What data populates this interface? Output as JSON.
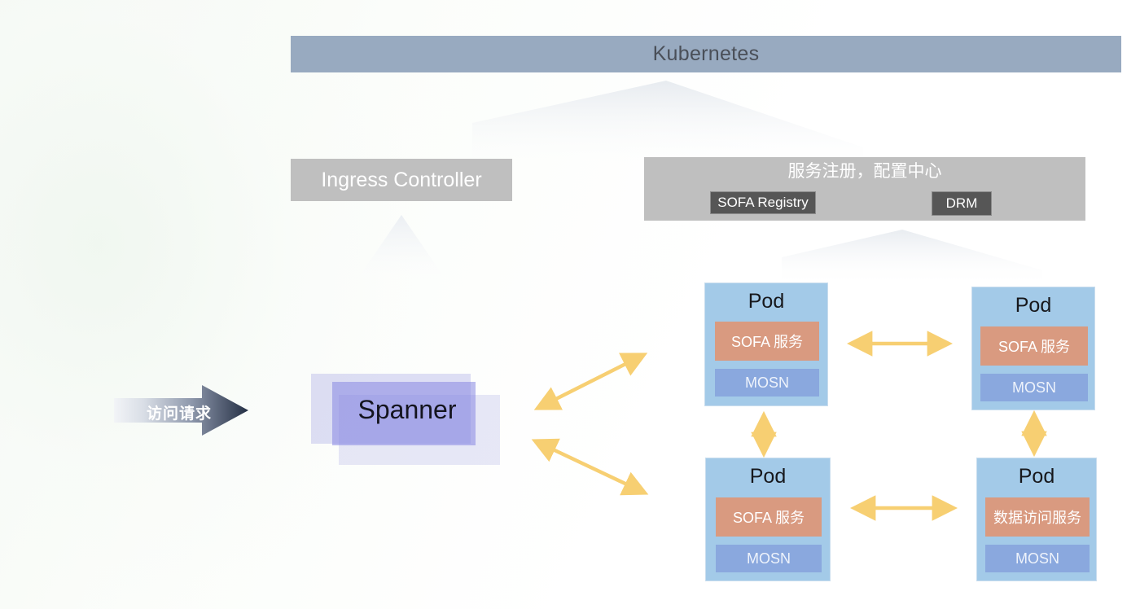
{
  "diagram": {
    "title": "Kubernetes",
    "platform": {
      "label": "Kubernetes",
      "color": "#98aac0"
    },
    "ingress": {
      "label": "Ingress Controller",
      "color": "#bfbfbf"
    },
    "registry": {
      "title": "服务注册，配置中心",
      "color": "#bfbfbf",
      "components": [
        {
          "label": "SOFA Registry",
          "color": "#565656"
        },
        {
          "label": "DRM",
          "color": "#565656"
        }
      ]
    },
    "gateway": {
      "label": "Spanner",
      "color": "#8686e2"
    },
    "entry": {
      "label": "访问请求",
      "arrow_color_start": "#e8ebef",
      "arrow_color_end": "#2b3448"
    },
    "pods": [
      {
        "title": "Pod",
        "service": {
          "label": "SOFA 服务",
          "color": "#d99a80"
        },
        "sidecar": {
          "label": "MOSN",
          "color": "#8aa8de"
        },
        "position": "top-left"
      },
      {
        "title": "Pod",
        "service": {
          "label": "SOFA 服务",
          "color": "#d99a80"
        },
        "sidecar": {
          "label": "MOSN",
          "color": "#8aa8de"
        },
        "position": "top-right"
      },
      {
        "title": "Pod",
        "service": {
          "label": "SOFA 服务",
          "color": "#d99a80"
        },
        "sidecar": {
          "label": "MOSN",
          "color": "#8aa8de"
        },
        "position": "bottom-left"
      },
      {
        "title": "Pod",
        "service": {
          "label": "数据访问服务",
          "color": "#d99a80"
        },
        "sidecar": {
          "label": "MOSN",
          "color": "#8aa8de"
        },
        "position": "bottom-right"
      }
    ],
    "connectors": {
      "color": "#f7cf72",
      "style": "double-headed",
      "links": [
        {
          "from": "Spanner",
          "to": "Pod top-left"
        },
        {
          "from": "Spanner",
          "to": "Pod bottom-left"
        },
        {
          "from": "Pod top-left",
          "to": "Pod top-right"
        },
        {
          "from": "Pod bottom-left",
          "to": "Pod bottom-right"
        },
        {
          "from": "Pod top-left",
          "to": "Pod bottom-left"
        },
        {
          "from": "Pod top-right",
          "to": "Pod bottom-right"
        }
      ]
    },
    "hint_shapes": {
      "color": "#f2f4f7",
      "items": [
        {
          "name": "kubernetes-down-chevron"
        },
        {
          "name": "ingress-up-triangle"
        },
        {
          "name": "registry-down-chevron"
        }
      ]
    }
  }
}
